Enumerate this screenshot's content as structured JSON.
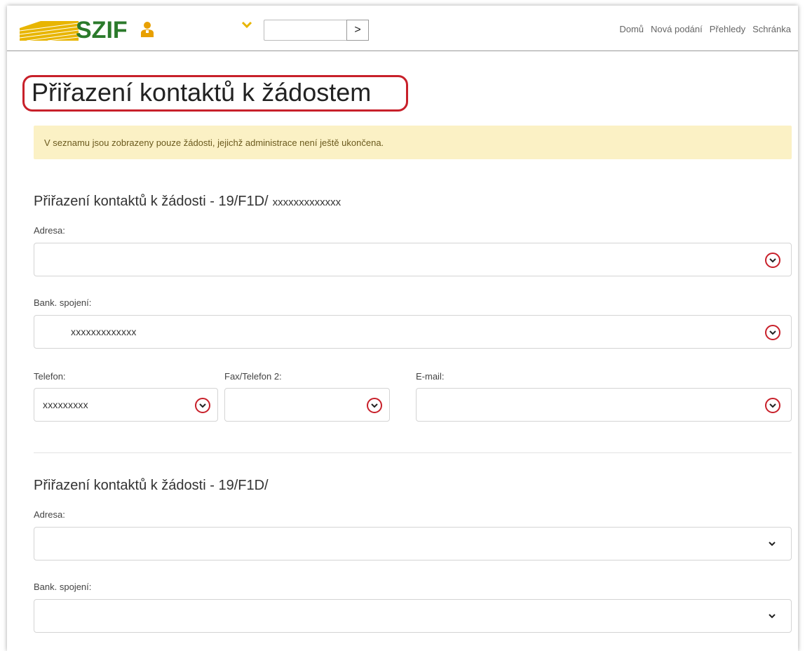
{
  "header": {
    "logo": "SZIF",
    "search_value": "",
    "go_label": ">",
    "nav": [
      "Domů",
      "Nová podání",
      "Přehledy",
      "Schránka"
    ]
  },
  "page": {
    "title": "Přiřazení kontaktů k žádostem",
    "notice": "V seznamu jsou zobrazeny pouze žádosti, jejichž administrace není ještě ukončena."
  },
  "sections": [
    {
      "title": "Přiřazení kontaktů k žádosti - 19/F1D/",
      "title_suffix": "xxxxxxxxxxxxx",
      "address_label": "Adresa:",
      "address_value": "",
      "bank_label": "Bank. spojení:",
      "bank_value": "xxxxxxxxxxxxx",
      "phone_label": "Telefon:",
      "phone_value": "xxxxxxxxx",
      "fax_label": "Fax/Telefon 2:",
      "fax_value": "",
      "email_label": "E-mail:",
      "email_value": ""
    },
    {
      "title": "Přiřazení kontaktů k žádosti - 19/F1D/",
      "address_label": "Adresa:",
      "address_value": "",
      "bank_label": "Bank. spojení:",
      "bank_value": ""
    }
  ],
  "colors": {
    "brand_green": "#2b7a2b",
    "brand_yellow": "#e8b500",
    "highlight_red": "#c8202a",
    "notice_bg": "#fbf1c5"
  }
}
